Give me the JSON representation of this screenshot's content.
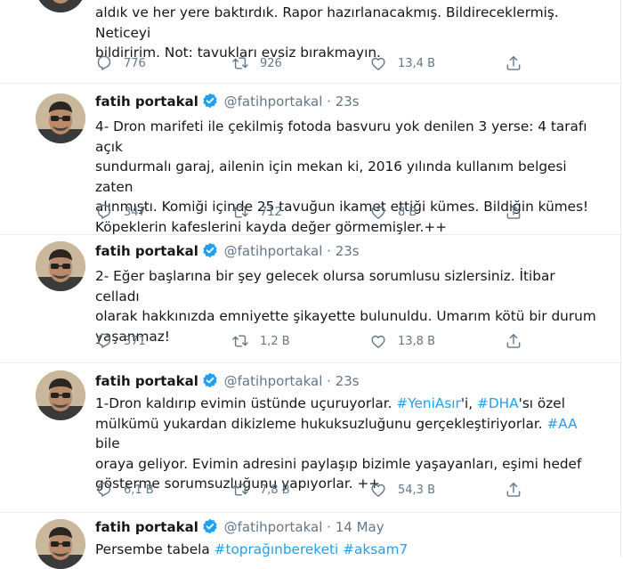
{
  "tweets": [
    {
      "text": "aldık ve her yere baktırdık. Rapor hazırlanacakmış. Bildireceklermiş. Neticeyi\nbildiririm. Not: tavukları evsiz bırakmayın.",
      "replies": "776",
      "retweets": "926",
      "likes": "13,4 B"
    },
    {
      "name": "fatih portakal",
      "handle": "@fatihportakal",
      "dot": "·",
      "time": "23s",
      "text": "4- Dron marifeti ile çekilmiş fotoda basvuru yok denilen 3 yerse: 4 tarafı açık\nsundurmalı garaj, ailenin için mekan ki, 2016 yılında kullanım belgesi zaten\nalınmıştı. Komiği içinde 25 tavuğun ikamet ettiği kümes. Bildiğin kümes!\nKöpeklerin kafeslerini kayda değer görmemişler.++",
      "replies": "347",
      "retweets": "712",
      "likes": "8 B"
    },
    {
      "name": "fatih portakal",
      "handle": "@fatihportakal",
      "dot": "·",
      "time": "23s",
      "text": "2- Eğer başlarına bir şey gelecek olursa sorumlusu sizlersiniz. İtibar celladı\nolarak hakkınızda emniyette şikayette bulunuldu. Umarım kötü bir durum\nyaşanmaz!",
      "replies": "371",
      "retweets": "1,2 B",
      "likes": "13,8 B"
    },
    {
      "name": "fatih portakal",
      "handle": "@fatihportakal",
      "dot": "·",
      "time": "23s",
      "text_parts": {
        "p1": "1-Dron kaldırıp evimin üstünde uçuruyorlar. ",
        "tag1": "#YeniAsır",
        "p2": "'i, ",
        "tag2": "#DHA",
        "p3": "'sı özel\nmülkümü yukardan dikizleme hukuksuzluğunu gerçekleştiriyorlar. ",
        "tag3": "#AA",
        "p4": " bile\noraya geliyor. Evimin adresini paylaşıp bizimle yaşayanları, eşimi hedef\ngösterme sorumsuzluğunu yapıyorlar. ++"
      },
      "replies": "6,1 B",
      "retweets": "7,8 B",
      "likes": "54,3 B"
    },
    {
      "name": "fatih portakal",
      "handle": "@fatihportakal",
      "dot": "·",
      "time": "14 May",
      "text_parts": {
        "p1": "Persembe tabela ",
        "tag1": "#toprağınbereketi",
        "p2": " ",
        "tag2": "#aksam7"
      }
    }
  ],
  "icons": {
    "reply": "reply-icon",
    "retweet": "retweet-icon",
    "like": "heart-icon",
    "share": "share-icon",
    "verified": "verified-badge-icon"
  },
  "colors": {
    "link": "#1da1f2",
    "secondary_text": "#657786",
    "divider": "#e6ecf0"
  }
}
